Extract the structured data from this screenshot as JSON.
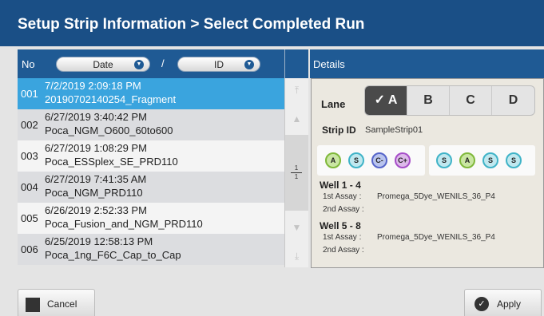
{
  "title": "Setup Strip Information > Select Completed Run",
  "list": {
    "col_no": "No",
    "sort_date": "Date",
    "sort_sep": "/",
    "sort_id": "ID",
    "rows": [
      {
        "no": "001",
        "date": "7/2/2019 2:09:18 PM",
        "name": "20190702140254_Fragment",
        "selected": true
      },
      {
        "no": "002",
        "date": "6/27/2019 3:40:42 PM",
        "name": "Poca_NGM_O600_60to600"
      },
      {
        "no": "003",
        "date": "6/27/2019 1:08:29 PM",
        "name": "Poca_ESSplex_SE_PRD110"
      },
      {
        "no": "004",
        "date": "6/27/2019 7:41:35 AM",
        "name": "Poca_NGM_PRD110"
      },
      {
        "no": "005",
        "date": "6/26/2019 2:52:33 PM",
        "name": "Poca_Fusion_and_NGM_PRD110"
      },
      {
        "no": "006",
        "date": "6/25/2019 12:58:13 PM",
        "name": "Poca_1ng_F6C_Cap_to_Cap"
      }
    ],
    "page_current": "1",
    "page_total": "1"
  },
  "details": {
    "header": "Details",
    "lane_label": "Lane",
    "lanes": [
      "A",
      "B",
      "C",
      "D"
    ],
    "active_lane_mark": "✓",
    "strip_id_label": "Strip ID",
    "strip_id_value": "SampleStrip01",
    "wells_left": [
      "A",
      "S",
      "C-",
      "C+"
    ],
    "wells_right": [
      "S",
      "A",
      "S",
      "S"
    ],
    "well_1_4": {
      "title": "Well 1 - 4",
      "assay1_label": "1st Assay :",
      "assay1_value": "Promega_5Dye_WENILS_36_P4",
      "assay2_label": "2nd Assay :",
      "assay2_value": ""
    },
    "well_5_8": {
      "title": "Well 5 - 8",
      "assay1_label": "1st Assay :",
      "assay1_value": "Promega_5Dye_WENILS_36_P4",
      "assay2_label": "2nd Assay :",
      "assay2_value": ""
    }
  },
  "buttons": {
    "cancel": "Cancel",
    "apply": "Apply"
  },
  "colors": {
    "title_bar": "#1a4f86",
    "header": "#1f5a94",
    "selected_row": "#3aa4de"
  }
}
